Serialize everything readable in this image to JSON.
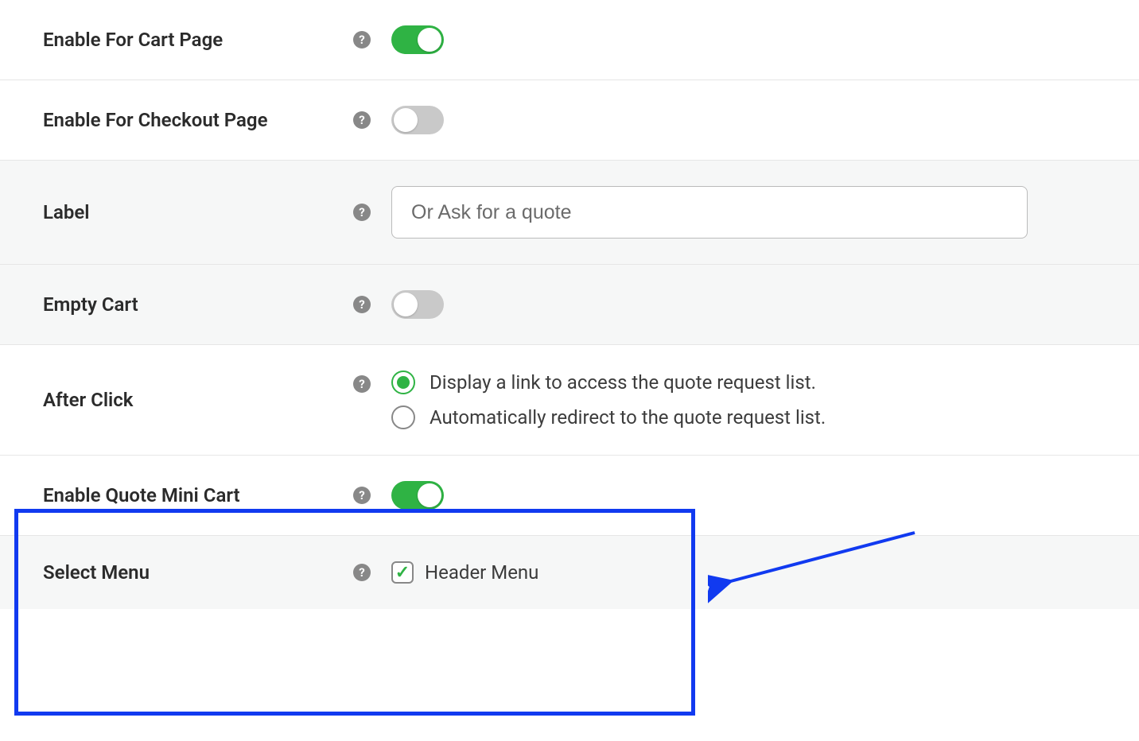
{
  "rows": {
    "enable_cart": {
      "label": "Enable For Cart Page"
    },
    "enable_checkout": {
      "label": "Enable For Checkout Page"
    },
    "label": {
      "label": "Label",
      "placeholder": "Or Ask for a quote",
      "value": ""
    },
    "empty_cart": {
      "label": "Empty Cart"
    },
    "after_click": {
      "label": "After Click",
      "opt1": "Display a link to access the quote request list.",
      "opt2": "Automatically redirect to the quote request list."
    },
    "enable_mini": {
      "label": "Enable Quote Mini Cart"
    },
    "select_menu": {
      "label": "Select Menu",
      "opt": "Header Menu"
    }
  }
}
